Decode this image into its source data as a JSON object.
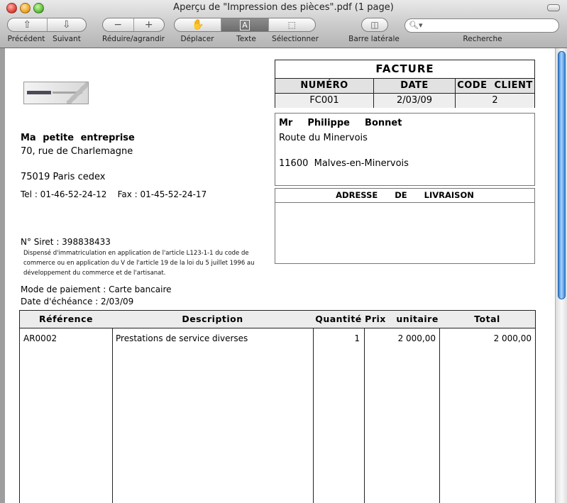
{
  "window": {
    "title": "Aperçu de \"Impression des pièces\".pdf (1 page)"
  },
  "toolbar": {
    "previous": "Précédent",
    "next": "Suivant",
    "zoom": "Réduire/agrandir",
    "move": "Déplacer",
    "text": "Texte",
    "select": "Sélectionner",
    "sidebar": "Barre latérale",
    "search": "Recherche",
    "search_value": ""
  },
  "invoice": {
    "title": "FACTURE",
    "headers": {
      "number": "NUMÉRO",
      "date": "DATE",
      "client_code": "CODE  CLIENT"
    },
    "number": "FC001",
    "date": "2/03/09",
    "client_code": "2"
  },
  "company": {
    "name": "Ma  petite  entreprise",
    "street": "70, rue de Charlemagne",
    "city": "75019 Paris cedex",
    "phone_fax": "Tel : 01-46-52-24-12    Fax : 01-45-52-24-17",
    "siret": "N° Siret : 398838433",
    "legal": "Dispensé d'immatriculation en application de l'article L123-1-1 du code de commerce ou en application du V de l'article 19 de la loi du 5 juillet 1996 au développement du commerce et de l'artisanat."
  },
  "payment": {
    "mode": "Mode de paiement : Carte bancaire",
    "due": "Date d'échéance : 2/03/09"
  },
  "client": {
    "name": "Mr  Philippe  Bonnet",
    "street": "Route du Minervois",
    "city": "11600  Malves-en-Minervois"
  },
  "delivery": {
    "title": "ADRESSE  DE  LIVRAISON"
  },
  "items": {
    "headers": [
      "Référence",
      "Description",
      "Quantité",
      "Prix   unitaire",
      "Total"
    ],
    "rows": [
      {
        "reference": "AR0002",
        "description": "Prestations de service diverses",
        "quantity": "1",
        "unit_price": "2 000,00",
        "total": "2 000,00"
      }
    ]
  }
}
